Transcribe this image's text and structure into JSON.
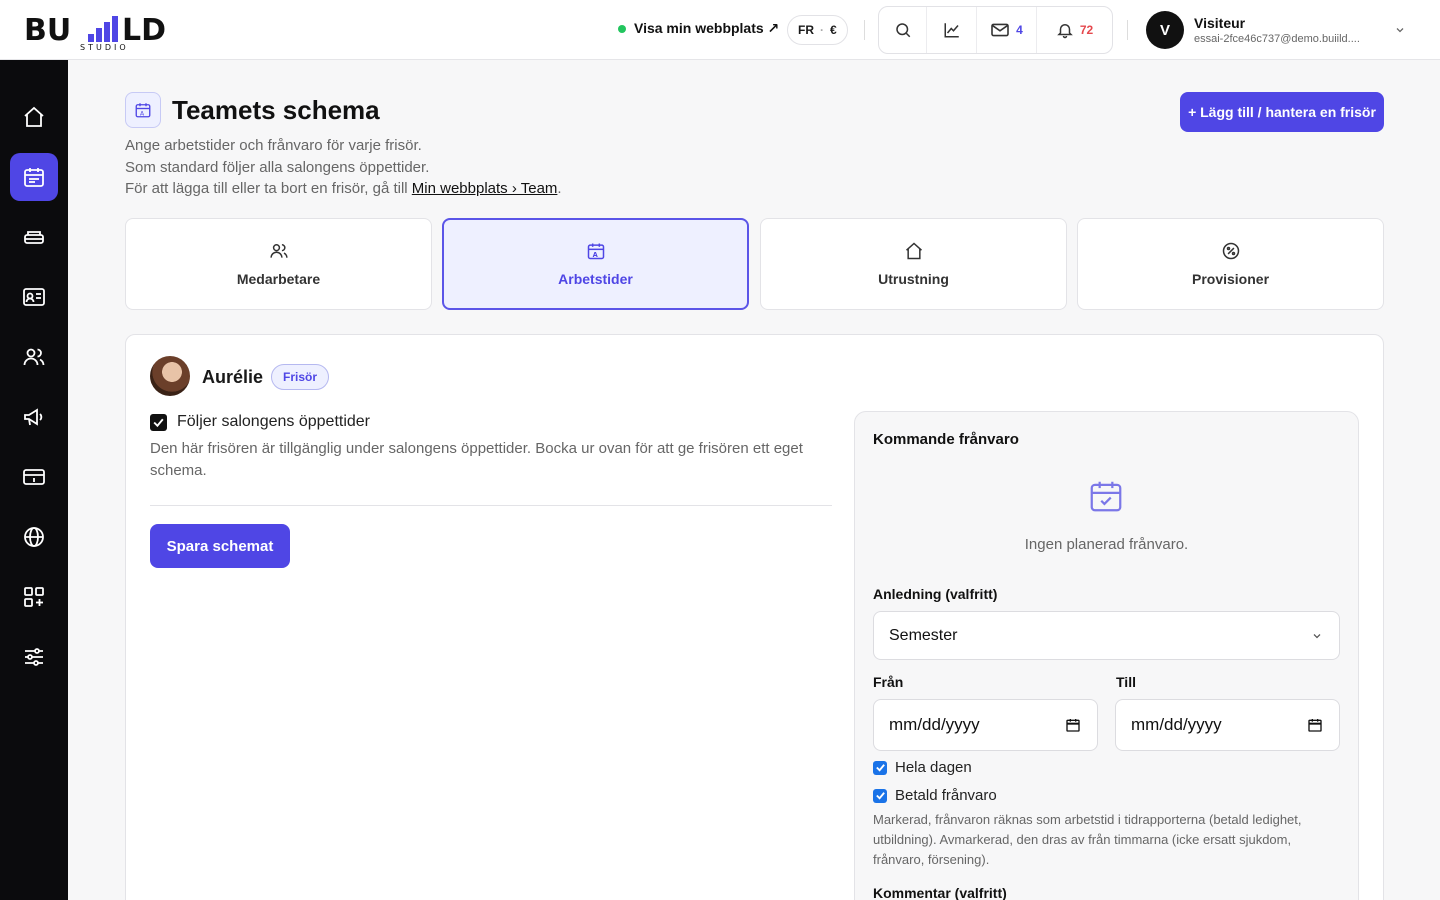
{
  "brand": {
    "logo_text": "BUILD",
    "logo_sub": "STUDIO"
  },
  "topbar": {
    "visit_site_label": "Visa min webbplats ↗",
    "lang": "FR",
    "currency": "€",
    "messages_count": "4",
    "notifications_count": "72",
    "user_initial": "V",
    "user_name": "Visiteur",
    "user_email": "essai-2fce46c737@demo.buiild...."
  },
  "sidebar": {
    "items": [
      {
        "icon": "home-icon",
        "active": false
      },
      {
        "icon": "calendar-icon",
        "active": true
      },
      {
        "icon": "inventory-icon",
        "active": false
      },
      {
        "icon": "id-card-icon",
        "active": false
      },
      {
        "icon": "users-icon",
        "active": false
      },
      {
        "icon": "megaphone-icon",
        "active": false
      },
      {
        "icon": "cash-register-icon",
        "active": false
      },
      {
        "icon": "globe-icon",
        "active": false
      },
      {
        "icon": "apps-plus-icon",
        "active": false
      },
      {
        "icon": "sliders-icon",
        "active": false
      }
    ]
  },
  "header": {
    "title": "Teamets schema",
    "desc_line1": "Ange arbetstider och frånvaro för varje frisör.",
    "desc_line2": "Som standard följer alla salongens öppettider.",
    "desc_line3_prefix": "För att lägga till eller ta bort en frisör, gå till ",
    "desc_link": "Min webbplats › Team",
    "desc_line3_suffix": ".",
    "add_button": "+ Lägg till / hantera en frisör"
  },
  "tabs": [
    {
      "label": "Medarbetare",
      "icon": "users-icon",
      "active": false
    },
    {
      "label": "Arbetstider",
      "icon": "calendar-icon",
      "active": true
    },
    {
      "label": "Utrustning",
      "icon": "home-icon",
      "active": false
    },
    {
      "label": "Provisioner",
      "icon": "percent-icon",
      "active": false
    }
  ],
  "staff": {
    "name": "Aurélie",
    "role": "Frisör",
    "follow_label": "Följer salongens öppettider",
    "follow_checked": true,
    "follow_help": "Den här frisören är tillgänglig under salongens öppettider. Bocka ur ovan för att ge frisören ett eget schema.",
    "save_button": "Spara schemat"
  },
  "absence": {
    "title": "Kommande frånvaro",
    "empty_text": "Ingen planerad frånvaro.",
    "reason_label": "Anledning (valfritt)",
    "reason_value": "Semester",
    "from_label": "Från",
    "to_label": "Till",
    "from_value": "mm/dd/yyyy",
    "to_value": "mm/dd/yyyy",
    "all_day_label": "Hela dagen",
    "all_day_checked": true,
    "paid_label": "Betald frånvaro",
    "paid_checked": true,
    "paid_help": "Markerad, frånvaron räknas som arbetstid i tidrapporterna (betald ledighet, utbildning). Avmarkerad, den dras av från timmarna (icke ersatt sjukdom, frånvaro, försening).",
    "comment_label": "Kommentar (valfritt)"
  },
  "colors": {
    "accent": "#4f46e5",
    "sidebar_bg": "#0b0b0d",
    "online": "#22c55e",
    "alert": "#e5484d"
  }
}
